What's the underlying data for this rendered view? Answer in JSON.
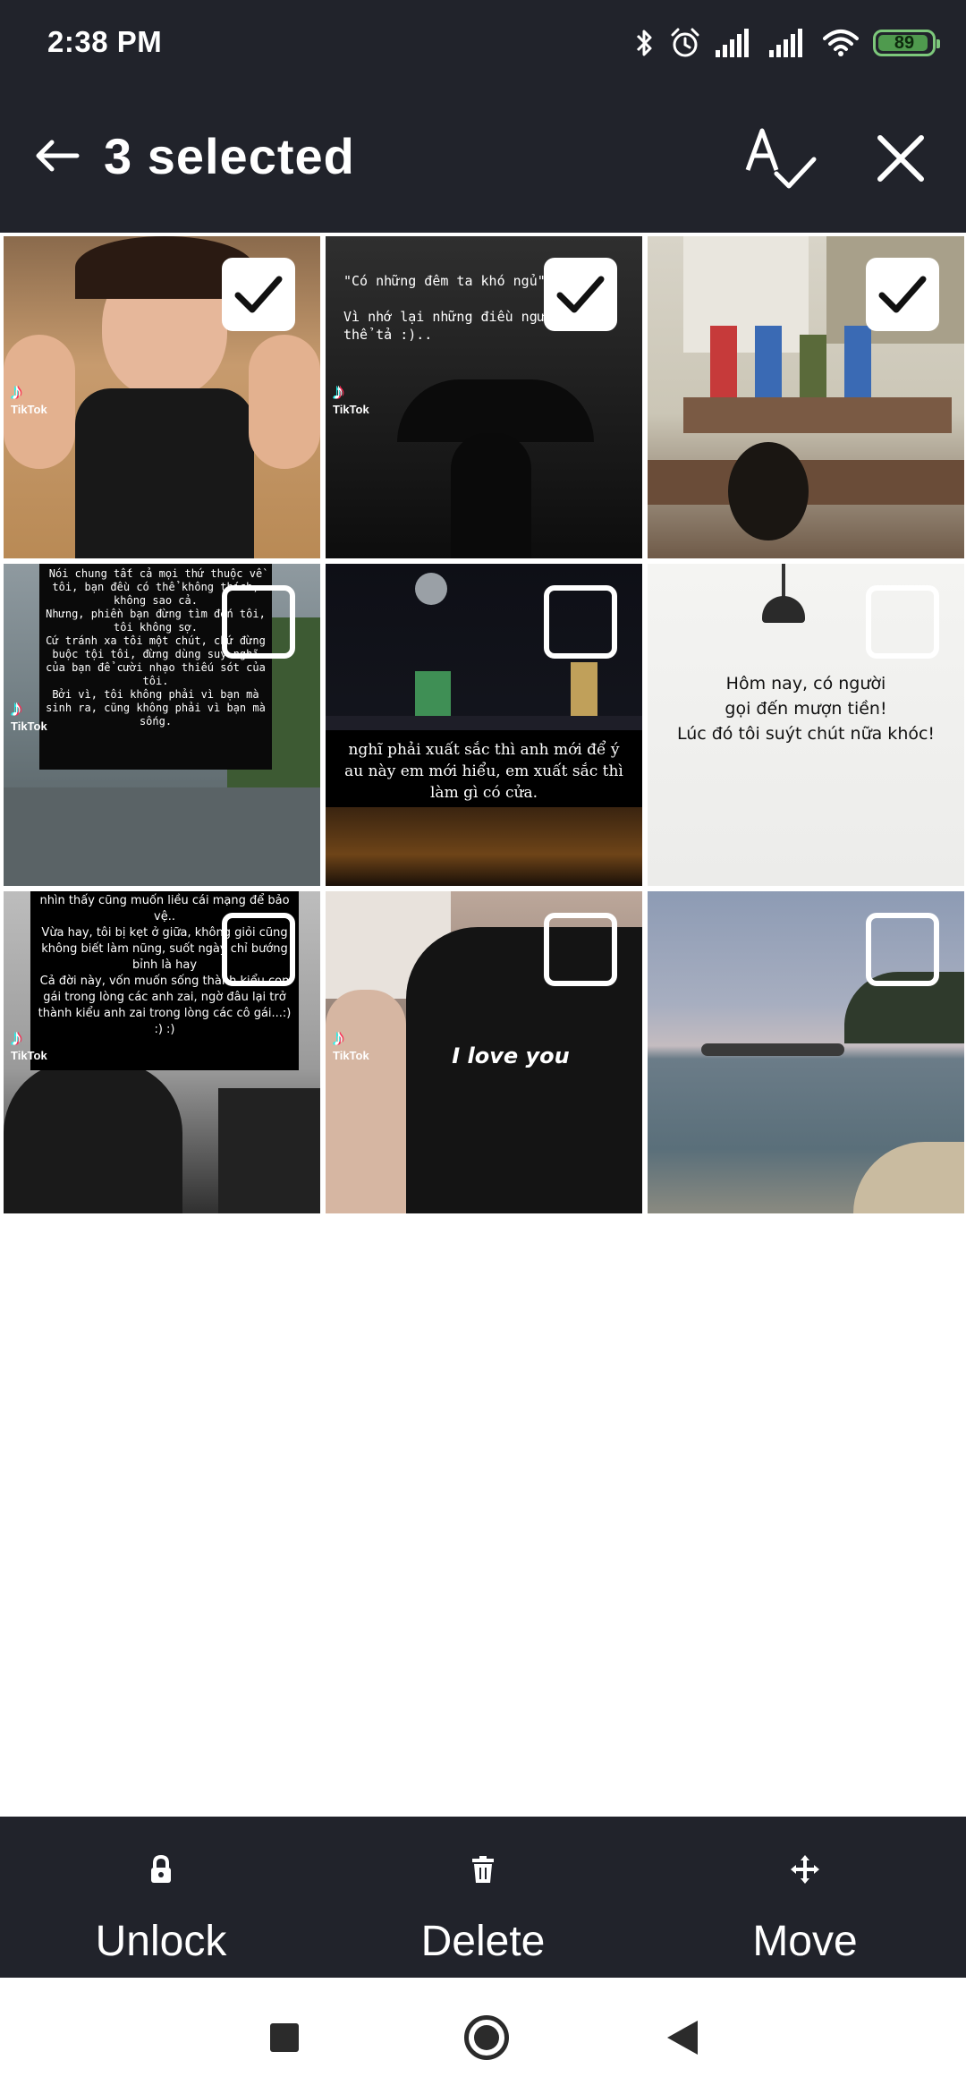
{
  "status_bar": {
    "time": "2:38 PM",
    "battery_level": "89",
    "icons": [
      "bluetooth-icon",
      "alarm-icon",
      "signal-icon",
      "signal-icon",
      "wifi-icon",
      "battery-icon"
    ]
  },
  "app_bar": {
    "title": "3 selected",
    "icons": [
      "back-arrow-icon",
      "spellcheck-icon",
      "close-icon"
    ]
  },
  "grid": {
    "items": [
      {
        "selected": true,
        "tiktok_label": "TikTok",
        "overlay_text": ""
      },
      {
        "selected": true,
        "tiktok_label": "TikTok",
        "overlay_text": "\"Có những đêm ta khó ngủ\"\n\nVì nhớ lại những điều người không thể tả :).."
      },
      {
        "selected": true,
        "tiktok_label": "",
        "overlay_text": ""
      },
      {
        "selected": false,
        "tiktok_label": "TikTok",
        "overlay_text": "Nói chung tất cả mọi thứ thuộc về tôi, bạn đều có thể không thích, không sao cả.\nNhưng, phiền bạn đừng tìm đến tôi, tôi không sợ.\nCứ tránh xa tôi một chút, chứ đừng buộc tội tôi, đừng dùng suy nghĩ của bạn để cười nhạo thiếu sót của tôi.\nBởi vì, tôi không phải vì bạn mà sinh ra, cũng không phải vì bạn mà sống."
      },
      {
        "selected": false,
        "tiktok_label": "",
        "overlay_text": "nghĩ phải xuất sắc thì anh mới để ý\nau này em mới hiểu, em xuất sắc thì\nlàm gì có cửa."
      },
      {
        "selected": false,
        "tiktok_label": "",
        "overlay_text": "Hôm nay, có người\ngọi đến mượn tiền!\nLúc đó tôi suýt chút nữa khóc!"
      },
      {
        "selected": false,
        "tiktok_label": "TikTok",
        "overlay_text": "nhìn thấy cũng muốn liều cái mạng để bảo vệ..\nVừa hay, tôi bị kẹt ở giữa, không giỏi cũng không biết làm nũng, suốt ngày chỉ bướng bỉnh là hay\nCả đời này, vốn muốn sống thành kiểu con gái trong lòng các anh zai, ngờ đâu lại trở thành kiểu anh zai trong lòng các cô gái...:) :) :)"
      },
      {
        "selected": false,
        "tiktok_label": "TikTok",
        "overlay_text": "I love you"
      },
      {
        "selected": false,
        "tiktok_label": "",
        "overlay_text": ""
      }
    ]
  },
  "action_bar": {
    "unlock_label": "Unlock",
    "delete_label": "Delete",
    "move_label": "Move"
  },
  "colors": {
    "bar_background": "#21232b",
    "battery_green": "#7dc87b",
    "check_background": "#ffffff"
  }
}
